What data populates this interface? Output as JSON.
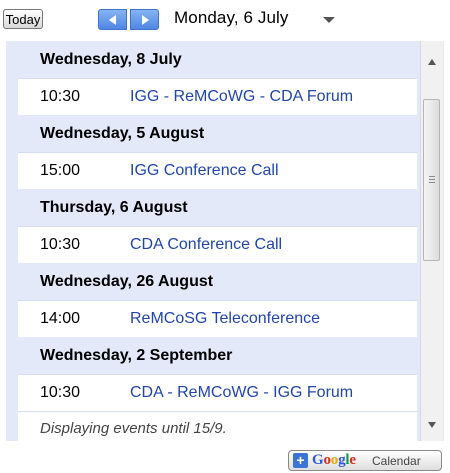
{
  "header": {
    "today_label": "Today",
    "current_date": "Monday, 6 July"
  },
  "agenda": {
    "days": [
      {
        "date": "Wednesday, 8 July",
        "events": [
          {
            "time": "10:30",
            "title": "IGG - ReMCoWG - CDA Forum"
          }
        ]
      },
      {
        "date": "Wednesday, 5 August",
        "events": [
          {
            "time": "15:00",
            "title": "IGG Conference Call"
          }
        ]
      },
      {
        "date": "Thursday, 6 August",
        "events": [
          {
            "time": "10:30",
            "title": "CDA Conference Call"
          }
        ]
      },
      {
        "date": "Wednesday, 26 August",
        "events": [
          {
            "time": "14:00",
            "title": "ReMCoSG Teleconference"
          }
        ]
      },
      {
        "date": "Wednesday, 2 September",
        "events": [
          {
            "time": "10:30",
            "title": "CDA - ReMCoWG - IGG Forum"
          }
        ]
      }
    ],
    "footer_note": "Displaying events until 15/9."
  },
  "footer": {
    "gcal_label": "Calendar"
  },
  "colors": {
    "accent": "#4f86e3",
    "event_link": "#2246a8",
    "day_header_bg": "#e3e9f8"
  }
}
